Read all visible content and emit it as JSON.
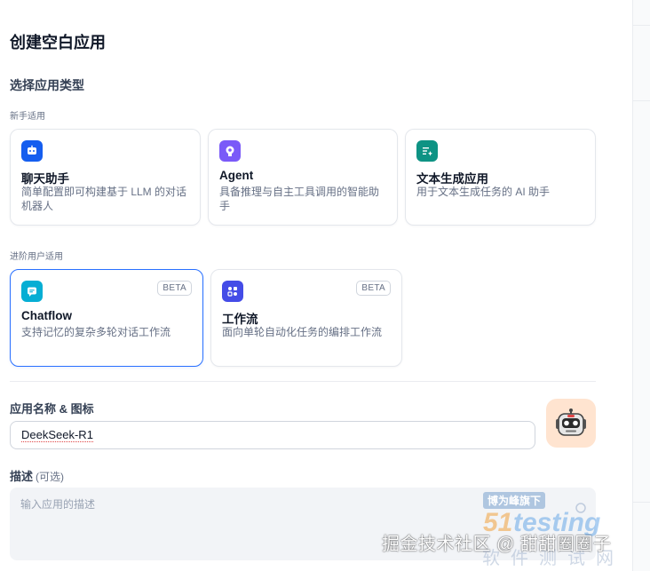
{
  "dialog": {
    "title": "创建空白应用"
  },
  "app_type_section": {
    "title": "选择应用类型",
    "beginner_label": "新手适用",
    "advanced_label": "进阶用户适用",
    "beginner_cards": [
      {
        "icon": "chat-bot-icon",
        "name": "聊天助手",
        "desc": "简单配置即可构建基于 LLM 的对话机器人",
        "color": "#155eef"
      },
      {
        "icon": "agent-icon",
        "name": "Agent",
        "desc": "具备推理与自主工具调用的智能助手",
        "color": "#7a5af8"
      },
      {
        "icon": "text-generator-icon",
        "name": "文本生成应用",
        "desc": "用于文本生成任务的 AI 助手",
        "color": "#0e9384"
      }
    ],
    "advanced_cards": [
      {
        "icon": "chatflow-icon",
        "name": "Chatflow",
        "desc": "支持记忆的复杂多轮对话工作流",
        "badge": "BETA",
        "color": "#06aed4",
        "selected": true
      },
      {
        "icon": "workflow-icon",
        "name": "工作流",
        "desc": "面向单轮自动化任务的编排工作流",
        "badge": "BETA",
        "color": "#444ce7",
        "selected": false
      }
    ]
  },
  "name_field": {
    "label": "应用名称 & 图标",
    "value": "DeekSeek-R1",
    "avatar_icon": "robot-icon"
  },
  "description_field": {
    "label": "描述",
    "optional": "(可选)",
    "placeholder": "输入应用的描述"
  },
  "watermarks": {
    "badge": "博为峰旗下",
    "logo_number": "51",
    "logo_word": "testing",
    "chinese": "软件测试网",
    "juejin": "掘金技术社区 @ 甜甜圈圈子"
  },
  "colors": {
    "accent": "#2970ff"
  }
}
